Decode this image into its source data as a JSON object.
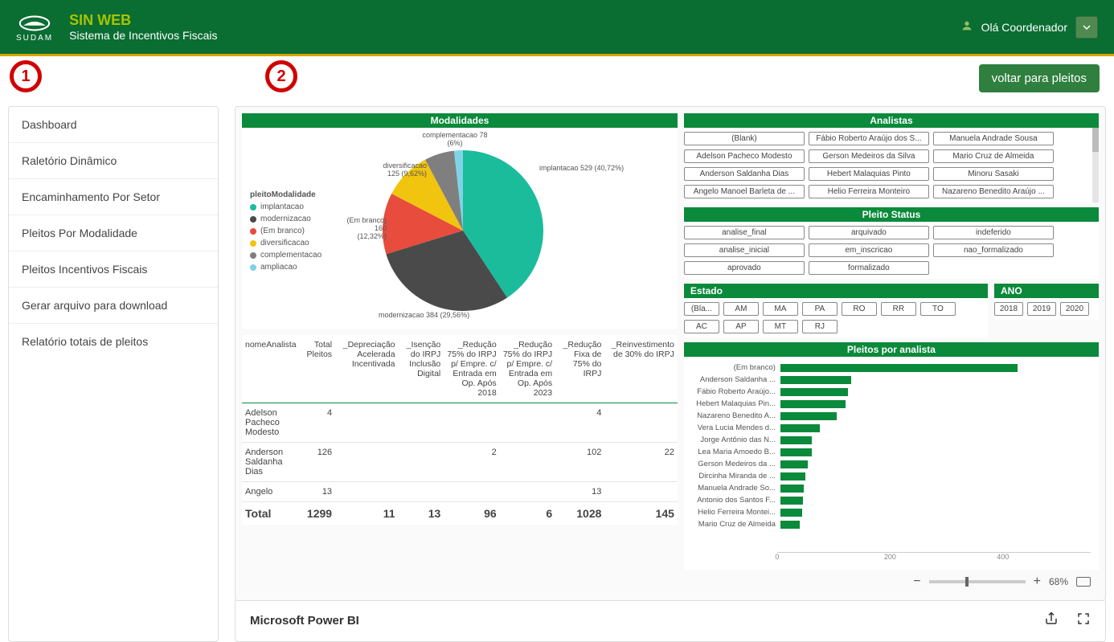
{
  "header": {
    "logo_text": "SUDAM",
    "title": "SIN WEB",
    "subtitle": "Sistema de Incentivos Fiscais",
    "greeting": "Olá Coordenador"
  },
  "annotations": {
    "a1": "1",
    "a2": "2"
  },
  "sidebar": {
    "items": [
      {
        "label": "Dashboard"
      },
      {
        "label": "Raletório Dinâmico"
      },
      {
        "label": "Encaminhamento Por Setor"
      },
      {
        "label": "Pleitos Por Modalidade"
      },
      {
        "label": "Pleitos Incentivos Fiscais"
      },
      {
        "label": "Gerar arquivo para download"
      },
      {
        "label": "Relatório totais de pleitos"
      }
    ]
  },
  "back_button": "voltar para pleitos",
  "modalidades": {
    "title": "Modalidades",
    "legend_title": "pleitoModalidade",
    "legend": [
      {
        "label": "implantacao",
        "color": "#1abc9c"
      },
      {
        "label": "modernizacao",
        "color": "#4a4a4a"
      },
      {
        "label": "(Em branco)",
        "color": "#e74c3c"
      },
      {
        "label": "diversificacao",
        "color": "#f1c40f"
      },
      {
        "label": "complementacao",
        "color": "#7f7f7f"
      },
      {
        "label": "ampliacao",
        "color": "#7fd3e6"
      }
    ],
    "labels": {
      "impl": "implantacao 529 (40,72%)",
      "mod": "modernizacao 384 (29,56%)",
      "blank": "(Em branco) 160 (12,32%)",
      "div": "diversificacao 125 (9,62%)",
      "comp": "complementacao 78 (6%)"
    }
  },
  "analistas": {
    "title": "Analistas",
    "items": [
      "(Blank)",
      "Fábio Roberto Araújo dos S...",
      "Manuela Andrade Sousa",
      "Adelson Pacheco Modesto",
      "Gerson Medeiros da Silva",
      "Mario Cruz de Almeida",
      "Anderson Saldanha Dias",
      "Hebert Malaquias Pinto",
      "Minoru Sasaki",
      "Angelo Manoel Barleta de ...",
      "Helio Ferreira Monteiro",
      "Nazareno Benedito Araújo ..."
    ]
  },
  "status": {
    "title": "Pleito Status",
    "items": [
      "analise_final",
      "arquivado",
      "indeferido",
      "analise_inicial",
      "em_inscricao",
      "nao_formalizado",
      "aprovado",
      "formalizado"
    ]
  },
  "estado": {
    "title": "Estado",
    "items": [
      "(Bla...",
      "AM",
      "MA",
      "PA",
      "RO",
      "RR",
      "TO",
      "AC",
      "AP",
      "MT",
      "RJ"
    ]
  },
  "ano": {
    "title": "ANO",
    "items": [
      "2018",
      "2019",
      "2020"
    ]
  },
  "table": {
    "headers": [
      "nomeAnalista",
      "Total Pleitos",
      "_Depreciação Acelerada Incentivada",
      "_Isenção do IRPJ Inclusão Digital",
      "_Redução 75% do IRPJ p/ Empre. c/ Entrada em Op. Após 2018",
      "_Redução 75% do IRPJ p/ Empre. c/ Entrada em Op. Após 2023",
      "_Redução Fixa de 75% do IRPJ",
      "_Reinvestimento de 30% do IRPJ"
    ],
    "rows": [
      {
        "c": [
          "Adelson Pacheco Modesto",
          "4",
          "",
          "",
          "",
          "",
          "4",
          ""
        ]
      },
      {
        "c": [
          "Anderson Saldanha Dias",
          "126",
          "",
          "",
          "2",
          "",
          "102",
          "22"
        ]
      },
      {
        "c": [
          "Angelo",
          "13",
          "",
          "",
          "",
          "",
          "13",
          ""
        ]
      }
    ],
    "total": [
      "Total",
      "1299",
      "11",
      "13",
      "96",
      "6",
      "1028",
      "145"
    ]
  },
  "barchart": {
    "title": "Pleitos por analista",
    "max": 550,
    "ticks": [
      "0",
      "200",
      "400"
    ],
    "items": [
      {
        "label": "(Em branco)",
        "v": 420
      },
      {
        "label": "Anderson Saldanha ...",
        "v": 126
      },
      {
        "label": "Fábio Roberto Araújo...",
        "v": 120
      },
      {
        "label": "Hebert Malaquias Pin...",
        "v": 115
      },
      {
        "label": "Nazareno Benedito A...",
        "v": 100
      },
      {
        "label": "Vera Lucia Mendes d...",
        "v": 70
      },
      {
        "label": "Jorge Antônio das N...",
        "v": 55
      },
      {
        "label": "Lea Maria Amoedo B...",
        "v": 55
      },
      {
        "label": "Gerson Medeiros da ...",
        "v": 48
      },
      {
        "label": "Dircinha Miranda de ...",
        "v": 45
      },
      {
        "label": "Manuela Andrade So...",
        "v": 42
      },
      {
        "label": "Antonio dos Santos F...",
        "v": 40
      },
      {
        "label": "Helio Ferreira Montei...",
        "v": 38
      },
      {
        "label": "Mario Cruz de Almeida",
        "v": 35
      }
    ]
  },
  "zoom": {
    "minus": "−",
    "plus": "+",
    "pct": "68%"
  },
  "footer": {
    "brand": "Microsoft Power BI"
  },
  "chart_data": [
    {
      "type": "pie",
      "title": "Modalidades",
      "series": [
        {
          "name": "pleitoModalidade",
          "values": [
            529,
            384,
            160,
            125,
            78,
            23
          ]
        }
      ],
      "categories": [
        "implantacao",
        "modernizacao",
        "(Em branco)",
        "diversificacao",
        "complementacao",
        "ampliacao"
      ],
      "percentages": [
        40.72,
        29.56,
        12.32,
        9.62,
        6.0,
        1.78
      ]
    },
    {
      "type": "bar",
      "title": "Pleitos por analista",
      "categories": [
        "(Em branco)",
        "Anderson Saldanha",
        "Fábio Roberto Araújo",
        "Hebert Malaquias Pinto",
        "Nazareno Benedito A.",
        "Vera Lucia Mendes d.",
        "Jorge Antônio das N.",
        "Lea Maria Amoedo B.",
        "Gerson Medeiros da",
        "Dircinha Miranda de",
        "Manuela Andrade So.",
        "Antonio dos Santos F.",
        "Helio Ferreira Montei.",
        "Mario Cruz de Almeida"
      ],
      "values": [
        420,
        126,
        120,
        115,
        100,
        70,
        55,
        55,
        48,
        45,
        42,
        40,
        38,
        35
      ],
      "xlabel": "",
      "ylabel": "",
      "xlim": [
        0,
        550
      ]
    },
    {
      "type": "table",
      "title": "nomeAnalista totals",
      "columns": [
        "nomeAnalista",
        "Total Pleitos",
        "_Depreciação Acelerada Incentivada",
        "_Isenção do IRPJ Inclusão Digital",
        "_Redução 75% do IRPJ p/ Empre. c/ Entrada em Op. Após 2018",
        "_Redução 75% do IRPJ p/ Empre. c/ Entrada em Op. Após 2023",
        "_Redução Fixa de 75% do IRPJ",
        "_Reinvestimento de 30% do IRPJ"
      ],
      "rows": [
        [
          "Adelson Pacheco Modesto",
          4,
          null,
          null,
          null,
          null,
          4,
          null
        ],
        [
          "Anderson Saldanha Dias",
          126,
          null,
          null,
          2,
          null,
          102,
          22
        ],
        [
          "Angelo",
          13,
          null,
          null,
          null,
          null,
          13,
          null
        ]
      ],
      "totals": [
        "Total",
        1299,
        11,
        13,
        96,
        6,
        1028,
        145
      ]
    }
  ]
}
